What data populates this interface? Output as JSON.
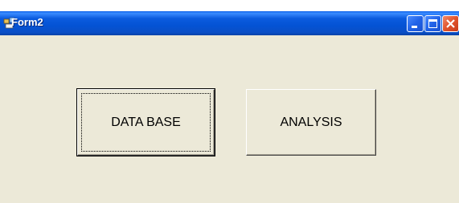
{
  "window": {
    "title": "Form2",
    "controls": {
      "minimize_icon": "minimize-icon",
      "maximize_icon": "maximize-icon",
      "close_icon": "close-icon"
    }
  },
  "buttons": {
    "database_label": "DATA BASE",
    "analysis_label": "ANALYSIS"
  },
  "colors": {
    "titlebar": "#0a54d6",
    "window_face": "#ece9d8",
    "close_button": "#e0532c"
  }
}
